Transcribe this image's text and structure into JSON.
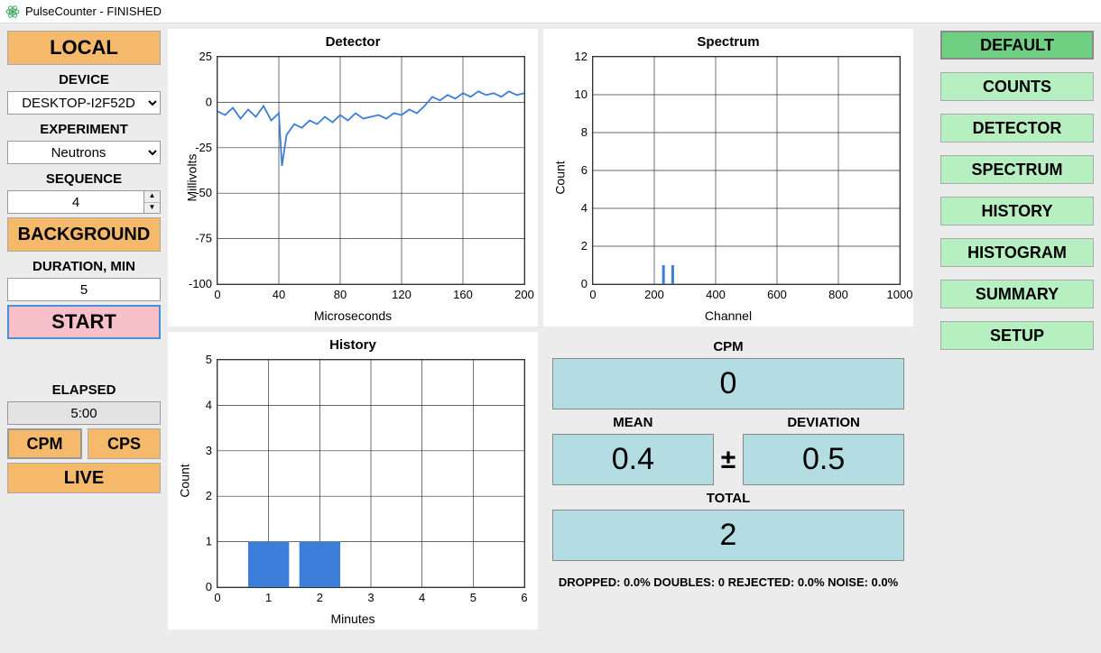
{
  "window_title": "PulseCounter - FINISHED",
  "left": {
    "local": "LOCAL",
    "device_label": "DEVICE",
    "device_value": "DESKTOP-I2F52D",
    "experiment_label": "EXPERIMENT",
    "experiment_value": "Neutrons",
    "sequence_label": "SEQUENCE",
    "sequence_value": "4",
    "background": "BACKGROUND",
    "duration_label": "DURATION, MIN",
    "duration_value": "5",
    "start": "START",
    "elapsed_label": "ELAPSED",
    "elapsed_value": "5:00",
    "cpm": "CPM",
    "cps": "CPS",
    "live": "LIVE"
  },
  "right": {
    "buttons": [
      "DEFAULT",
      "COUNTS",
      "DETECTOR",
      "SPECTRUM",
      "HISTORY",
      "HISTOGRAM",
      "SUMMARY",
      "SETUP"
    ]
  },
  "stats": {
    "cpm_label": "CPM",
    "cpm_value": "0",
    "mean_label": "MEAN",
    "mean_value": "0.4",
    "deviation_label": "DEVIATION",
    "deviation_value": "0.5",
    "plusminus": "±",
    "total_label": "TOTAL",
    "total_value": "2",
    "footer": "DROPPED: 0.0%    DOUBLES: 0    REJECTED: 0.0%    NOISE: 0.0%"
  },
  "chart_data": [
    {
      "name": "detector",
      "type": "line",
      "title": "Detector",
      "xlabel": "Microseconds",
      "ylabel": "Millivolts",
      "xlim": [
        0,
        200
      ],
      "xticks": [
        0,
        40,
        80,
        120,
        160,
        200
      ],
      "ylim": [
        -100,
        25
      ],
      "yticks": [
        -100,
        -75,
        -50,
        -25,
        0,
        25
      ],
      "x": [
        0,
        5,
        10,
        15,
        20,
        25,
        30,
        35,
        40,
        42,
        45,
        50,
        55,
        60,
        65,
        70,
        75,
        80,
        85,
        90,
        95,
        100,
        105,
        110,
        115,
        120,
        125,
        130,
        135,
        140,
        145,
        150,
        155,
        160,
        165,
        170,
        175,
        180,
        185,
        190,
        195,
        200
      ],
      "y": [
        -5,
        -7,
        -3,
        -9,
        -4,
        -8,
        -2,
        -10,
        -6,
        -35,
        -18,
        -12,
        -14,
        -10,
        -12,
        -8,
        -11,
        -7,
        -10,
        -6,
        -9,
        -8,
        -7,
        -9,
        -6,
        -7,
        -4,
        -6,
        -2,
        3,
        1,
        4,
        2,
        5,
        3,
        6,
        4,
        5,
        3,
        6,
        4,
        5
      ]
    },
    {
      "name": "spectrum",
      "type": "bar",
      "title": "Spectrum",
      "xlabel": "Channel",
      "ylabel": "Count",
      "xlim": [
        0,
        1000
      ],
      "xticks": [
        0,
        200,
        400,
        600,
        800,
        1000
      ],
      "ylim": [
        0,
        12
      ],
      "yticks": [
        0,
        2,
        4,
        6,
        8,
        10,
        12
      ],
      "bars": [
        {
          "x": 230,
          "y": 1
        },
        {
          "x": 260,
          "y": 1
        }
      ]
    },
    {
      "name": "history",
      "type": "bar",
      "title": "History",
      "xlabel": "Minutes",
      "ylabel": "Count",
      "xlim": [
        0,
        6
      ],
      "xticks": [
        0,
        1,
        2,
        3,
        4,
        5,
        6
      ],
      "ylim": [
        0,
        5
      ],
      "yticks": [
        0,
        1,
        2,
        3,
        4,
        5
      ],
      "bars": [
        {
          "x": 1,
          "y": 1,
          "w": 0.8
        },
        {
          "x": 2,
          "y": 1,
          "w": 0.8
        }
      ]
    }
  ]
}
